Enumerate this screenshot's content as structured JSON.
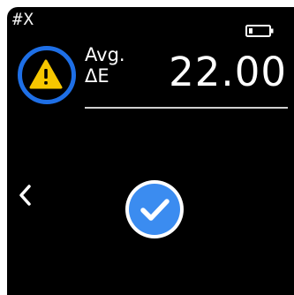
{
  "status_bar": {
    "label": "#X",
    "battery_icon": "battery-low-icon"
  },
  "measurement": {
    "label_top": "Avg.",
    "label_bottom": "ΔE",
    "value": "22.00",
    "status_icon": "warning-icon"
  },
  "navigation": {
    "back_icon": "chevron-left-icon"
  },
  "confirm": {
    "icon": "check-circle-icon"
  },
  "colors": {
    "background": "#000000",
    "accent": "#1e6fe6",
    "warning": "#f6c700",
    "confirm": "#3b8cf0",
    "text": "#ffffff"
  }
}
